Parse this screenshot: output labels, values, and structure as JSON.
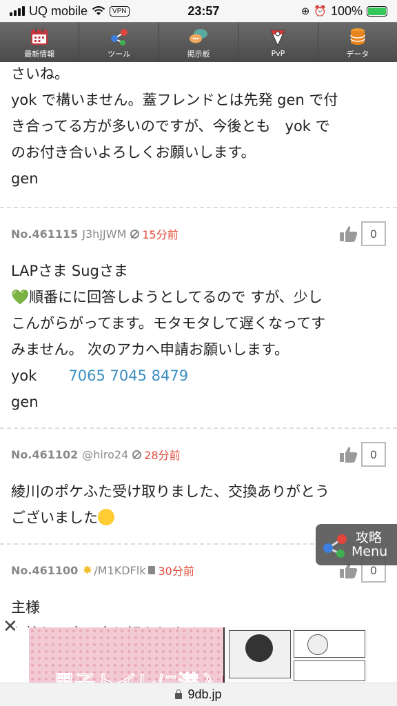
{
  "status_bar": {
    "carrier": "UQ mobile",
    "vpn_label": "VPN",
    "time": "23:57",
    "battery": "100%"
  },
  "nav": {
    "items": [
      {
        "label": "最新情報",
        "icon": "calendar-icon"
      },
      {
        "label": "ツール",
        "icon": "share-nodes-icon"
      },
      {
        "label": "掲示板",
        "icon": "chat-bubbles-icon"
      },
      {
        "label": "PvP",
        "icon": "league-badge-icon"
      },
      {
        "label": "データ",
        "icon": "database-icon"
      }
    ]
  },
  "top_text": {
    "lines": [
      "さいね。",
      "yok で構いません。蓋フレンドとは先発 gen で付",
      "き合ってる方が多いのですが、今後とも　yok で",
      "のお付き合いよろしくお願いします。",
      "gen"
    ]
  },
  "posts": [
    {
      "no": "No.461115",
      "user": "J3hJJWM",
      "time": "15分前",
      "likes": "0",
      "line1": "LAPさま Sugさま",
      "line2_heart": "💚",
      "line2": "順番にに回答しようとしてるので すが、少し",
      "line3": "こんがらがってます。モタモタして遅くなってす",
      "line4": "みません。 次のアカへ申請お願いします。",
      "line5_prefix": "yok",
      "line5_link": "7065 7045 8479",
      "line6": "gen"
    },
    {
      "no": "No.461102",
      "user": "@hiro24",
      "time": "28分前",
      "likes": "0",
      "line1": "綾川のポケふた受け取りました、交換ありがとう",
      "line2": "ございました"
    },
    {
      "no": "No.461100",
      "user": "/M1KDFlk",
      "time": "30分前",
      "likes": "0",
      "line1": "主様",
      "line2": "お忙しい中、申し訳ありません"
    }
  ],
  "float_menu": {
    "line1": "攻略",
    "line2": "Menu"
  },
  "ad": {
    "close": "✕",
    "title": "男子トイレに潜入!?"
  },
  "url_bar": {
    "domain": "9db.jp"
  },
  "colors": {
    "nav_bg": "#5b5b5b",
    "time_red": "#e24b3b",
    "link_blue": "#3a8fc2"
  }
}
